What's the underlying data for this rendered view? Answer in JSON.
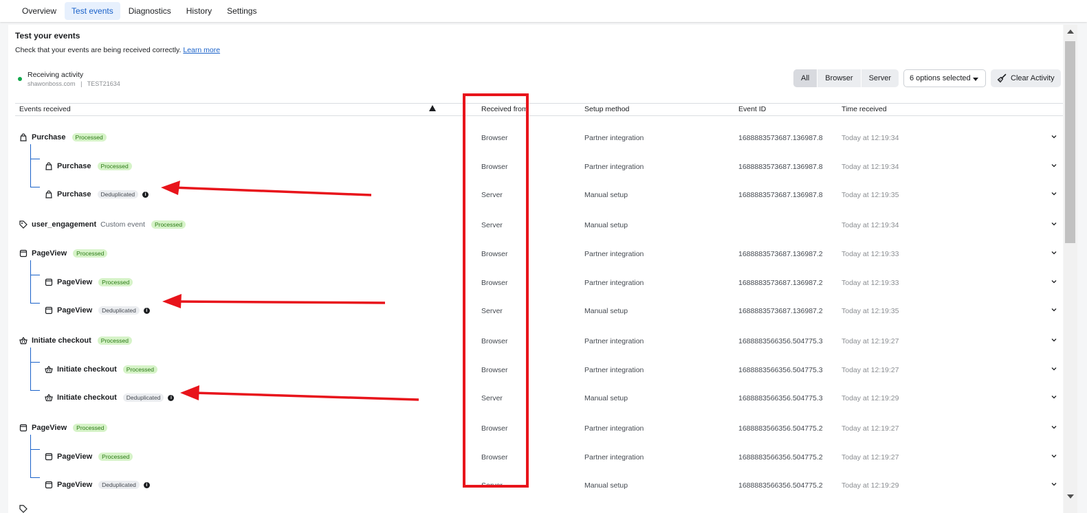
{
  "tabs": [
    {
      "label": "Overview"
    },
    {
      "label": "Test events"
    },
    {
      "label": "Diagnostics"
    },
    {
      "label": "History"
    },
    {
      "label": "Settings"
    }
  ],
  "header": {
    "title": "Test your events",
    "subtitle": "Check that your events are being received correctly.",
    "learn_more": "Learn more"
  },
  "activity": {
    "label": "Receiving activity",
    "domain": "shawonboss.com",
    "separator": "|",
    "test_code": "TEST21634"
  },
  "filters": {
    "segments": [
      "All",
      "Browser",
      "Server"
    ],
    "selected_segment": "All",
    "options": "6 options selected",
    "clear": "Clear Activity"
  },
  "columns": {
    "events": "Events received",
    "received_from": "Received from",
    "setup": "Setup method",
    "event_id": "Event ID",
    "time": "Time received"
  },
  "rows": [
    {
      "name": "Purchase",
      "icon": "bag-icon",
      "badge": "Processed",
      "from": "Browser",
      "setup": "Partner integration",
      "id": "1688883573687.136987.8",
      "time": "Today at 12:19:34"
    },
    {
      "name": "Purchase",
      "icon": "bag-icon",
      "badge": "Processed",
      "from": "Browser",
      "setup": "Partner integration",
      "id": "1688883573687.136987.8",
      "time": "Today at 12:19:34"
    },
    {
      "name": "Purchase",
      "icon": "bag-icon",
      "badge": "Deduplicated",
      "from": "Server",
      "setup": "Manual setup",
      "id": "1688883573687.136987.8",
      "time": "Today at 12:19:35"
    },
    {
      "name": "user_engagement",
      "icon": "tag-icon",
      "custom": "Custom event",
      "badge": "Processed",
      "from": "Server",
      "setup": "Manual setup",
      "id": "",
      "time": "Today at 12:19:34"
    },
    {
      "name": "PageView",
      "icon": "window-icon",
      "badge": "Processed",
      "from": "Browser",
      "setup": "Partner integration",
      "id": "1688883573687.136987.2",
      "time": "Today at 12:19:33"
    },
    {
      "name": "PageView",
      "icon": "window-icon",
      "badge": "Processed",
      "from": "Browser",
      "setup": "Partner integration",
      "id": "1688883573687.136987.2",
      "time": "Today at 12:19:33"
    },
    {
      "name": "PageView",
      "icon": "window-icon",
      "badge": "Deduplicated",
      "from": "Server",
      "setup": "Manual setup",
      "id": "1688883573687.136987.2",
      "time": "Today at 12:19:35"
    },
    {
      "name": "Initiate checkout",
      "icon": "basket-icon",
      "badge": "Processed",
      "from": "Browser",
      "setup": "Partner integration",
      "id": "1688883566356.504775.3",
      "time": "Today at 12:19:27"
    },
    {
      "name": "Initiate checkout",
      "icon": "basket-icon",
      "badge": "Processed",
      "from": "Browser",
      "setup": "Partner integration",
      "id": "1688883566356.504775.3",
      "time": "Today at 12:19:27"
    },
    {
      "name": "Initiate checkout",
      "icon": "basket-icon",
      "badge": "Deduplicated",
      "from": "Server",
      "setup": "Manual setup",
      "id": "1688883566356.504775.3",
      "time": "Today at 12:19:29"
    },
    {
      "name": "PageView",
      "icon": "window-icon",
      "badge": "Processed",
      "from": "Browser",
      "setup": "Partner integration",
      "id": "1688883566356.504775.2",
      "time": "Today at 12:19:27"
    },
    {
      "name": "PageView",
      "icon": "window-icon",
      "badge": "Processed",
      "from": "Browser",
      "setup": "Partner integration",
      "id": "1688883566356.504775.2",
      "time": "Today at 12:19:27"
    },
    {
      "name": "PageView",
      "icon": "window-icon",
      "badge": "Deduplicated",
      "from": "Server",
      "setup": "Manual setup",
      "id": "1688883566356.504775.2",
      "time": "Today at 12:19:29"
    }
  ],
  "colors": {
    "accent": "#1a62c9",
    "processed_bg": "#d6f3c8",
    "annotation": "#e8141b"
  }
}
